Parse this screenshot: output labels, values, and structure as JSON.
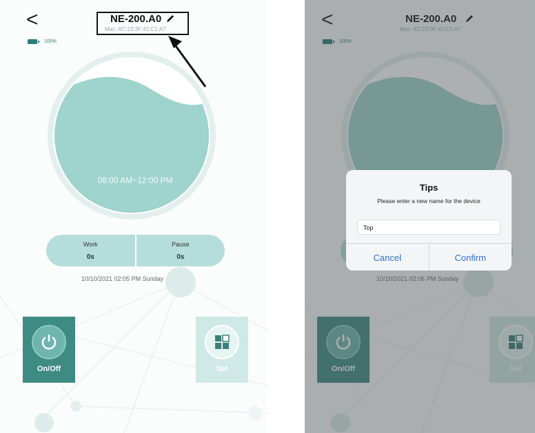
{
  "left": {
    "back_glyph": "<",
    "device_name": "NE-200.A0",
    "mac": "Mac: AC:23:3F:41:C1:A7",
    "battery": "100%",
    "gauge_time": "08:00 AM~12:00 PM",
    "work_label": "Work",
    "work_value": "0s",
    "pause_label": "Pause",
    "pause_value": "0s",
    "datetime": "10/10/2021 02:05 PM Sunday",
    "onoff_label": "On/Off",
    "set_label": "Set"
  },
  "right": {
    "back_glyph": "<",
    "device_name": "NE-200.A0",
    "mac": "Mac: AC:23:3F:41:C1:A7",
    "battery": "100%",
    "datetime": "10/10/2021 02:06 PM Sunday",
    "onoff_label": "On/Off",
    "set_label": "Set",
    "dialog": {
      "title": "Tips",
      "message": "Please enter a new name for the device",
      "input_value": "Top",
      "cancel_label": "Cancel",
      "confirm_label": "Confirm"
    }
  },
  "colors": {
    "accent": "#3e8b84",
    "liquid": "#9fd3cd",
    "dialog_button": "#2f6fd1"
  },
  "icons": [
    "back-chevron-icon",
    "edit-pencil-icon",
    "battery-icon",
    "power-icon",
    "set-grid-icon",
    "annotation-arrow-icon"
  ]
}
